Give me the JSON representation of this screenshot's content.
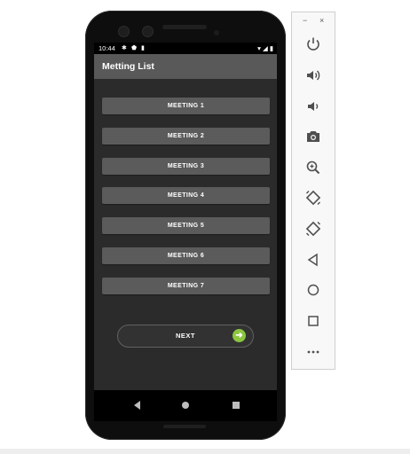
{
  "status_bar": {
    "time": "10:44"
  },
  "app_bar": {
    "title": "Metting List"
  },
  "meetings": [
    {
      "label": "MEETING 1"
    },
    {
      "label": "MEETING 2"
    },
    {
      "label": "MEETING 3"
    },
    {
      "label": "MEETING 4"
    },
    {
      "label": "MEETING 5"
    },
    {
      "label": "MEETING 6"
    },
    {
      "label": "MEETING 7"
    }
  ],
  "next_button": {
    "label": "NEXT",
    "accent_color": "#8cc63f"
  },
  "emulator_toolbar": {
    "window_controls": {
      "minimize": "−",
      "close": "×"
    },
    "tools": [
      "power-icon",
      "volume-up-icon",
      "volume-down-icon",
      "camera-icon",
      "zoom-icon",
      "rotate-left-icon",
      "rotate-right-icon",
      "back-icon",
      "home-icon",
      "overview-icon",
      "more-icon"
    ]
  }
}
